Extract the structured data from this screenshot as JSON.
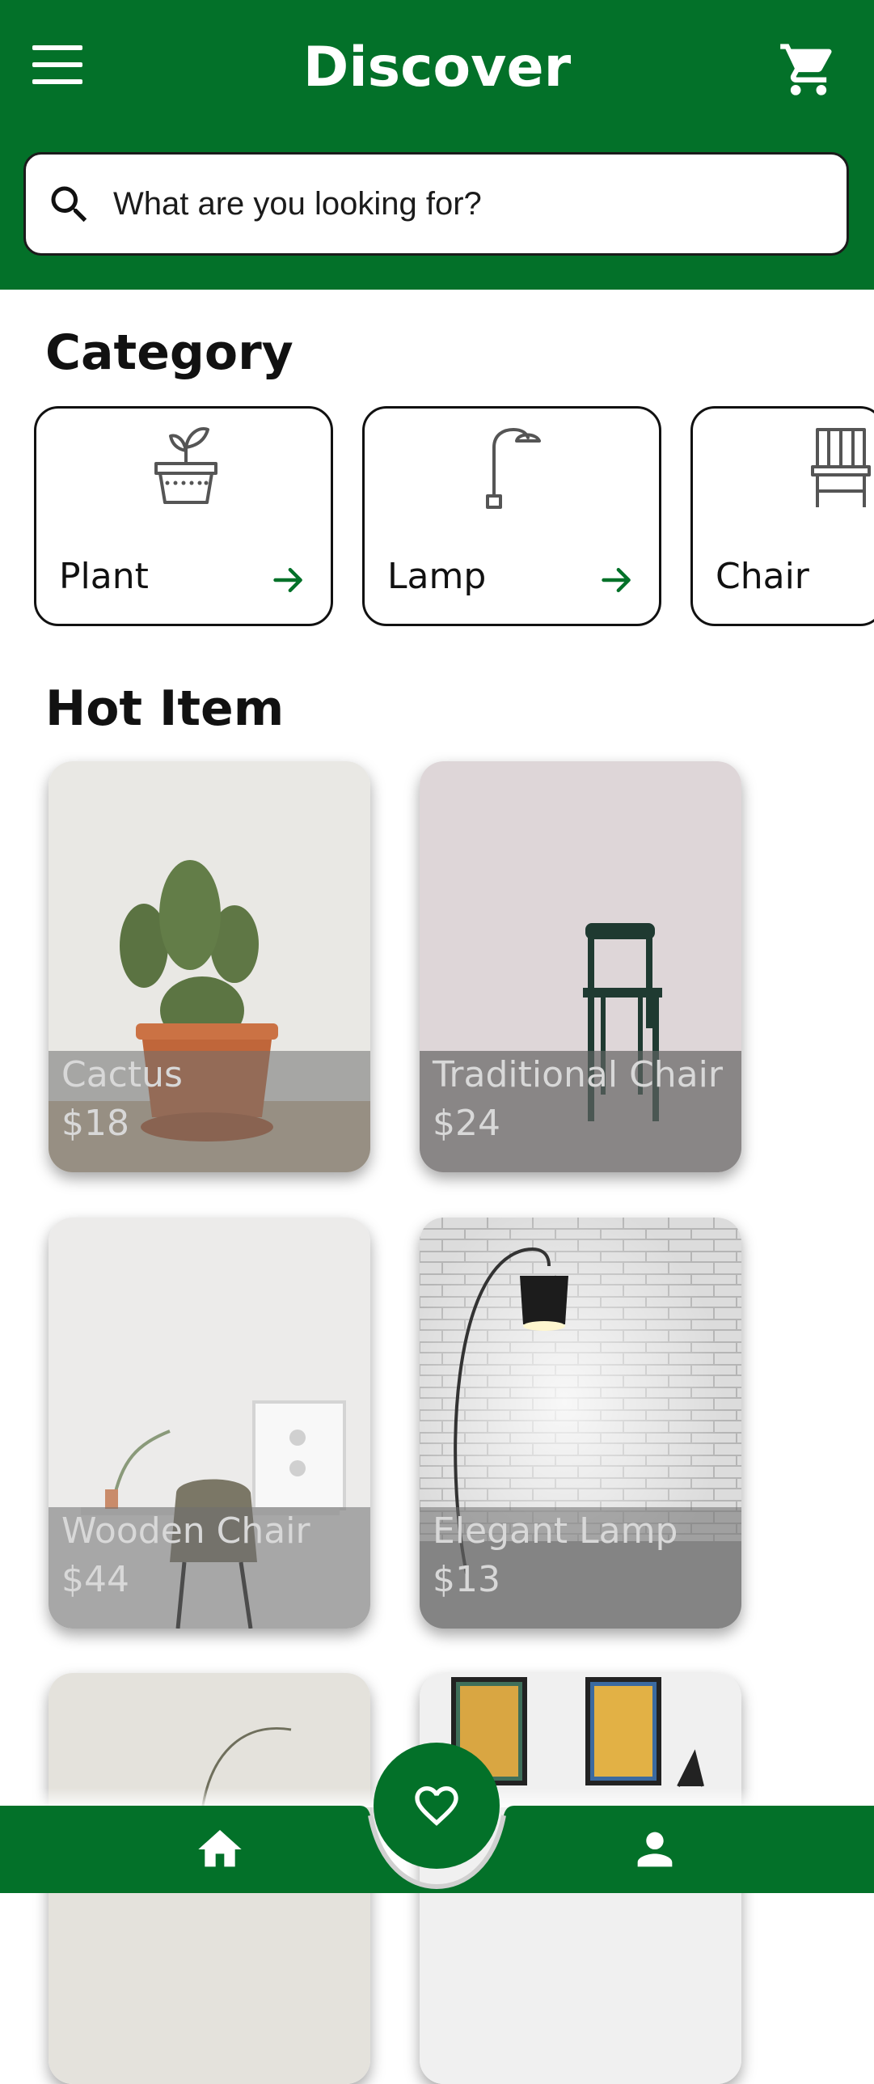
{
  "header": {
    "title": "Discover",
    "menu_icon": "menu-icon",
    "cart_icon": "cart-icon"
  },
  "search": {
    "placeholder": "What are you looking for?",
    "icon": "search-icon"
  },
  "category": {
    "title": "Category",
    "items": [
      {
        "label": "Plant",
        "icon": "plant-pot-icon"
      },
      {
        "label": "Lamp",
        "icon": "floor-lamp-icon"
      },
      {
        "label": "Chair",
        "icon": "chair-icon"
      }
    ]
  },
  "hot": {
    "title": "Hot Item",
    "items": [
      {
        "name": "Cactus",
        "price": "$18"
      },
      {
        "name": "Traditional Chair",
        "price": "$24"
      },
      {
        "name": "Wooden Chair",
        "price": "$44"
      },
      {
        "name": "Elegant Lamp",
        "price": "$13"
      }
    ]
  },
  "nav": {
    "items": [
      "home-icon",
      "heart-icon",
      "person-icon"
    ]
  },
  "colors": {
    "brand": "#037129",
    "background": "#ffffff",
    "text": "#111111"
  }
}
